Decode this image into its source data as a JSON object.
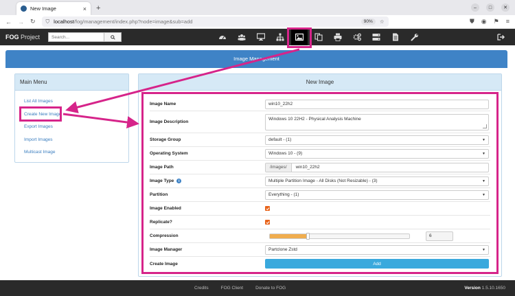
{
  "browser": {
    "tab_title": "New Image",
    "tab_close": "×",
    "new_tab": "+",
    "url_host": "localhost",
    "url_path": "/fog/management/index.php?node=image&sub=add",
    "zoom": "90%"
  },
  "fogbar": {
    "brand_bold": "FOG",
    "brand_rest": " Project",
    "search_placeholder": "Search...",
    "active_icon": "images"
  },
  "header": {
    "title": "Image Management"
  },
  "sidebar": {
    "title": "Main Menu",
    "items": [
      {
        "label": "List All Images"
      },
      {
        "label": "Create New Image"
      },
      {
        "label": "Export Images"
      },
      {
        "label": "Import Images"
      },
      {
        "label": "Multicast Image"
      }
    ]
  },
  "form": {
    "title": "New Image",
    "image_name": {
      "label": "Image Name",
      "value": "win10_22h2"
    },
    "image_description": {
      "label": "Image Description",
      "value": "Windows 10 22H2 - Physical Analysis Machine"
    },
    "storage_group": {
      "label": "Storage Group",
      "value": "default - (1)"
    },
    "operating_system": {
      "label": "Operating System",
      "value": "Windows 10 - (9)"
    },
    "image_path": {
      "label": "Image Path",
      "prefix": "/images/",
      "value": "win10_22h2"
    },
    "image_type": {
      "label": "Image Type",
      "info": "i",
      "value": "Multiple Partition Image - All Disks (Not Resizable) - (3)"
    },
    "partition": {
      "label": "Partition",
      "value": "Everything - (1)"
    },
    "image_enabled": {
      "label": "Image Enabled",
      "checked": true
    },
    "replicate": {
      "label": "Replicate?",
      "checked": true
    },
    "compression": {
      "label": "Compression",
      "value": "6",
      "fraction": 0.27
    },
    "image_manager": {
      "label": "Image Manager",
      "value": "Partclone Zstd"
    },
    "create_image": {
      "label": "Create Image",
      "button": "Add"
    }
  },
  "footer": {
    "links": [
      "Credits",
      "FOG Client",
      "Donate to FOG"
    ],
    "version_label": "Version",
    "version": "1.5.10.1650"
  },
  "colors": {
    "accent": "#3f83c6",
    "annotation": "#d6248a",
    "checkbox": "#e8641b",
    "add_button": "#3aa9dd"
  }
}
